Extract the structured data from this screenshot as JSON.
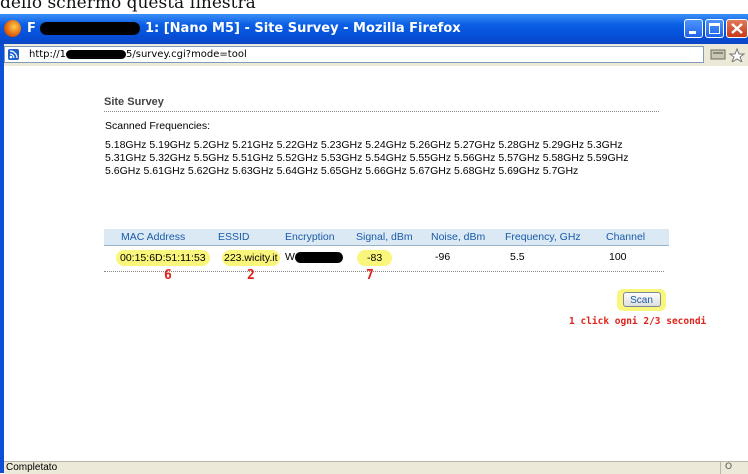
{
  "caption": "dello schermo questa finestra",
  "window": {
    "title_prefix": "F",
    "title_suffix": "1: [Nano M5] - Site Survey - Mozilla Firefox",
    "controls": [
      "minimize-icon",
      "maximize-icon",
      "close-icon"
    ]
  },
  "urlbar": {
    "url_prefix": "http://1",
    "url_suffix": "5/survey.cgi?mode=tool",
    "icons": [
      "rss-icon",
      "page-icon",
      "bookmark-star-icon"
    ]
  },
  "page": {
    "heading": "Site Survey",
    "scanned_label": "Scanned Frequencies:",
    "frequencies": "5.18GHz 5.19GHz 5.2GHz 5.21GHz 5.22GHz 5.23GHz 5.24GHz 5.26GHz 5.27GHz 5.28GHz 5.29GHz 5.3GHz 5.31GHz 5.32GHz 5.5GHz 5.51GHz 5.52GHz 5.53GHz 5.54GHz 5.55GHz 5.56GHz 5.57GHz 5.58GHz 5.59GHz 5.6GHz 5.61GHz 5.62GHz 5.63GHz 5.64GHz 5.65GHz 5.66GHz 5.67GHz 5.68GHz 5.69GHz 5.7GHz",
    "table": {
      "headers": [
        "MAC Address",
        "ESSID",
        "Encryption",
        "Signal, dBm",
        "Noise, dBm",
        "Frequency, GHz",
        "Channel"
      ],
      "rows": [
        {
          "mac": "00:15:6D:51:11:53",
          "essid": "223.wicity.it",
          "encryption": "W",
          "signal": "-83",
          "noise": "-96",
          "frequency": "5.5",
          "channel": "100"
        }
      ]
    },
    "annotations": {
      "mac": "6",
      "essid": "2",
      "signal": "7"
    },
    "scan_label": "Scan",
    "scan_note": "1 click ogni 2/3 secondi",
    "highlight_color": "#faf57b",
    "annotation_color": "#e0221a"
  },
  "statusbar": {
    "text": "Completato",
    "right": "O"
  }
}
